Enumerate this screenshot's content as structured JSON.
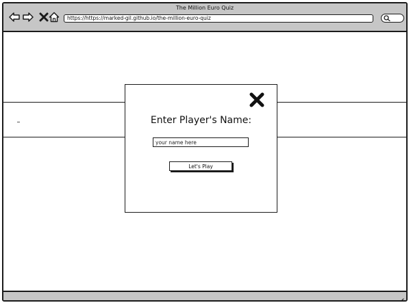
{
  "window": {
    "title": "The Million Euro Quiz"
  },
  "toolbar": {
    "icons": [
      "back-arrow-icon",
      "forward-arrow-icon",
      "close-icon",
      "home-icon"
    ],
    "address": "https://https://marked-gil.github.io/the-million-euro-quiz",
    "search_icon": "search-icon"
  },
  "modal": {
    "close_icon": "close-x-icon",
    "heading": "Enter Player's Name:",
    "input_placeholder": "your name here",
    "input_value": "",
    "button_label": "Let's Play"
  },
  "band": {
    "marker": "–"
  },
  "colors": {
    "chrome": "#c6c6c6",
    "ink": "#1a1a1a",
    "background": "#ffffff"
  }
}
